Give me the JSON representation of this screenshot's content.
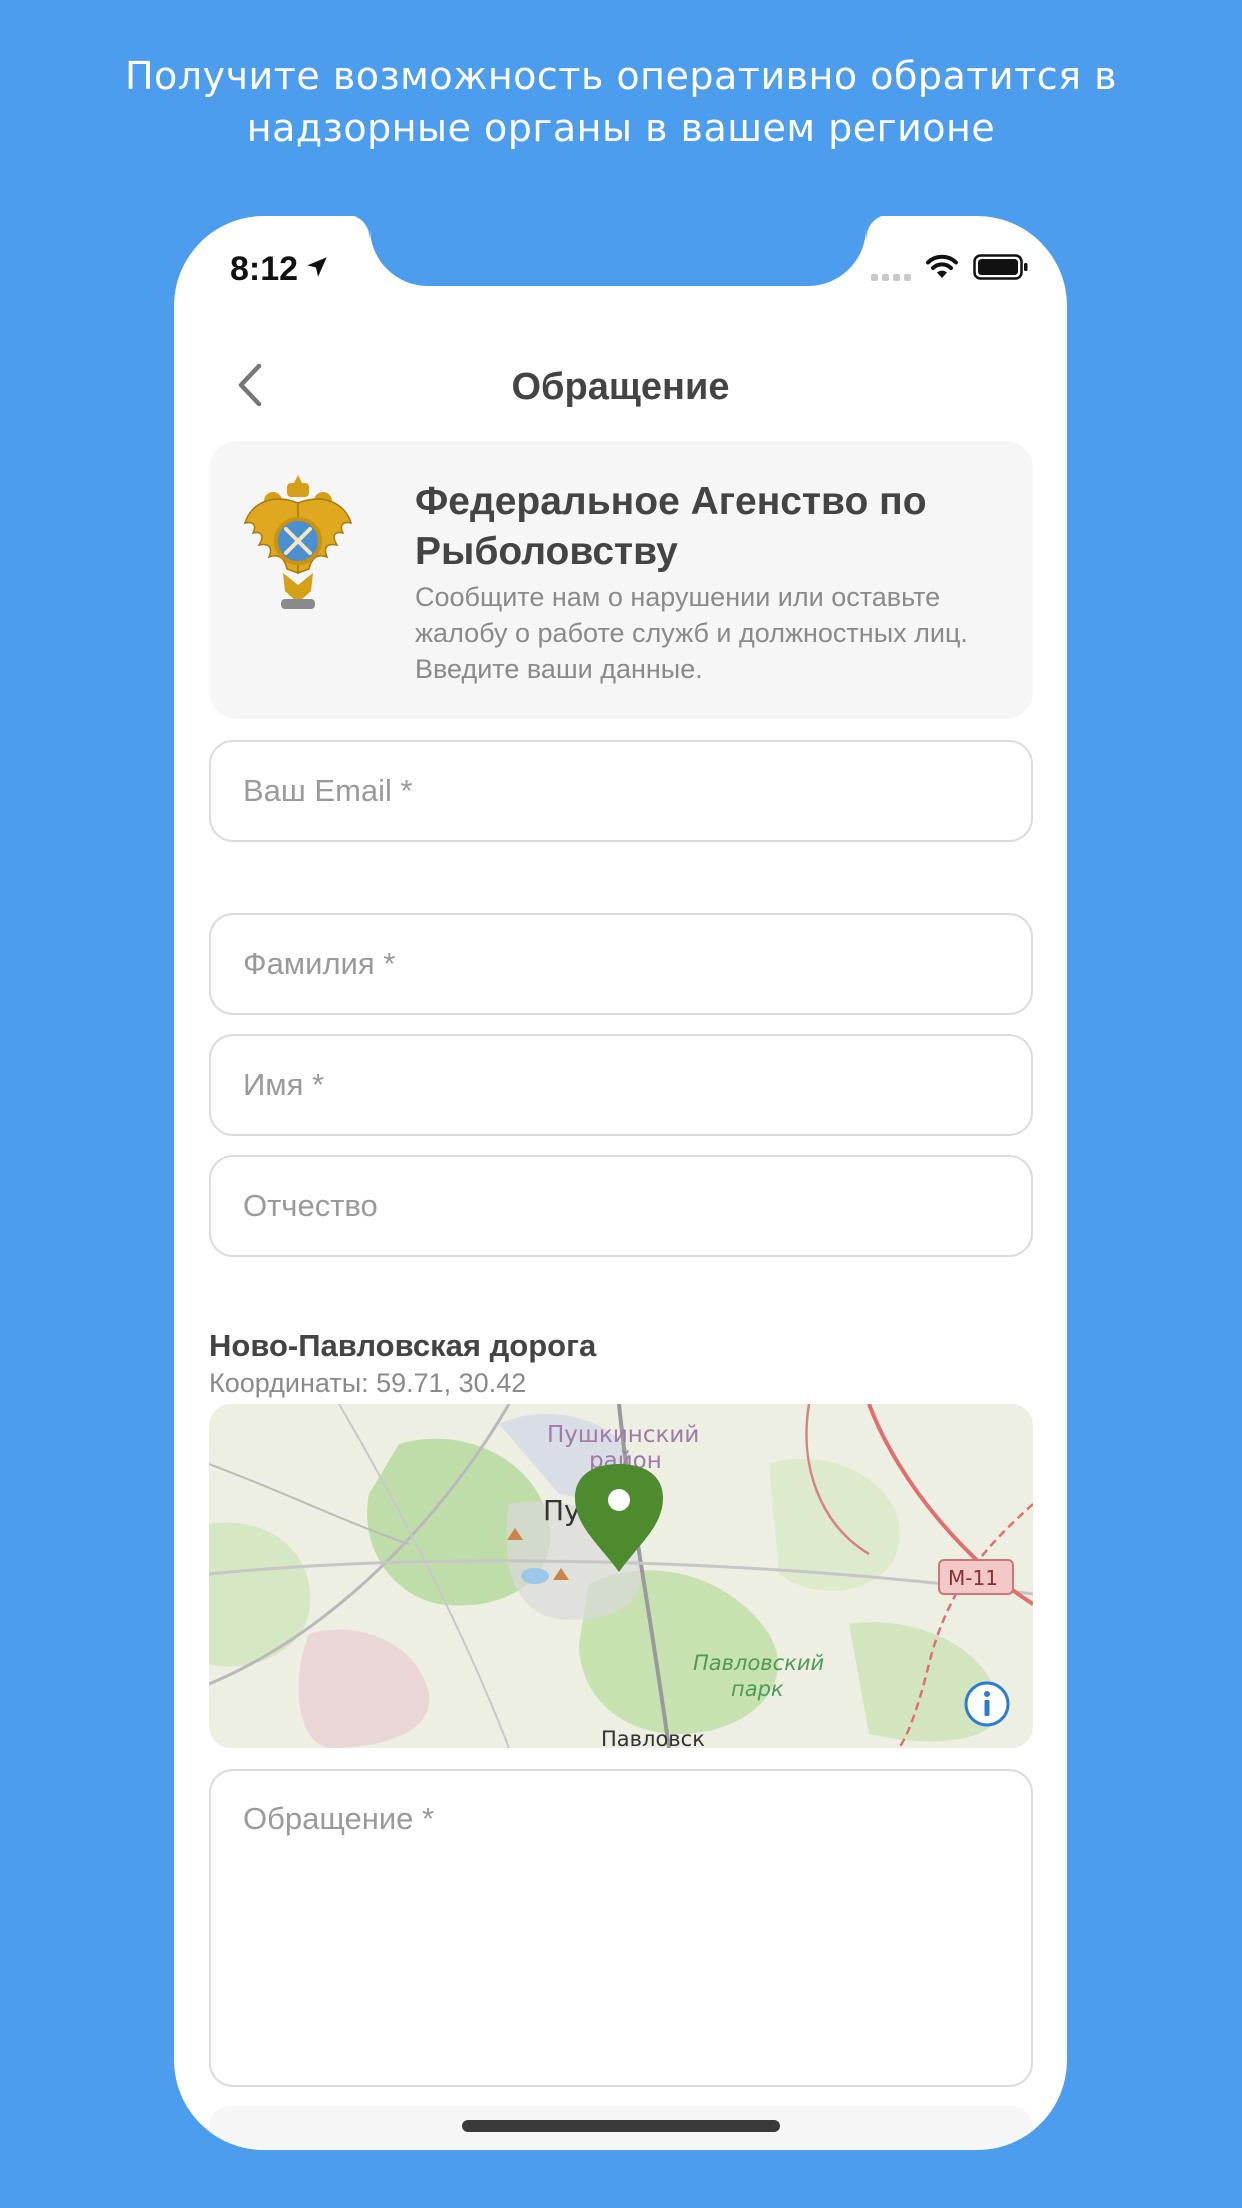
{
  "promo": {
    "line1": "Получите возможность оперативно обратится в",
    "line2": "надзорные органы в вашем регионе"
  },
  "status_bar": {
    "time": "8:12"
  },
  "nav": {
    "title": "Обращение"
  },
  "agency": {
    "title": "Федеральное Агенство по Рыболовству",
    "description": "Сообщите нам о нарушении или оставьте жалобу о работе служб и должностных лиц. Введите ваши данные."
  },
  "form": {
    "email_placeholder": "Ваш Email *",
    "lastname_placeholder": "Фамилия *",
    "firstname_placeholder": "Имя *",
    "middlename_placeholder": "Отчество",
    "message_placeholder": "Обращение *"
  },
  "location": {
    "title": "Ново-Павловская дорога",
    "coordinates": "Координаты: 59.71, 30.42"
  },
  "map": {
    "label_district_1": "Пушкинский",
    "label_district_2": "район",
    "label_city": "Пу",
    "label_park_1": "Павловский",
    "label_park_2": "парк",
    "label_town": "Павловск",
    "road_badge": "М-11",
    "pin_color": "#4E8A2E"
  },
  "colors": {
    "background": "#4C9DED",
    "card": "#F6F6F6",
    "text_dark": "#444444",
    "text_muted": "#8A8A8A"
  }
}
